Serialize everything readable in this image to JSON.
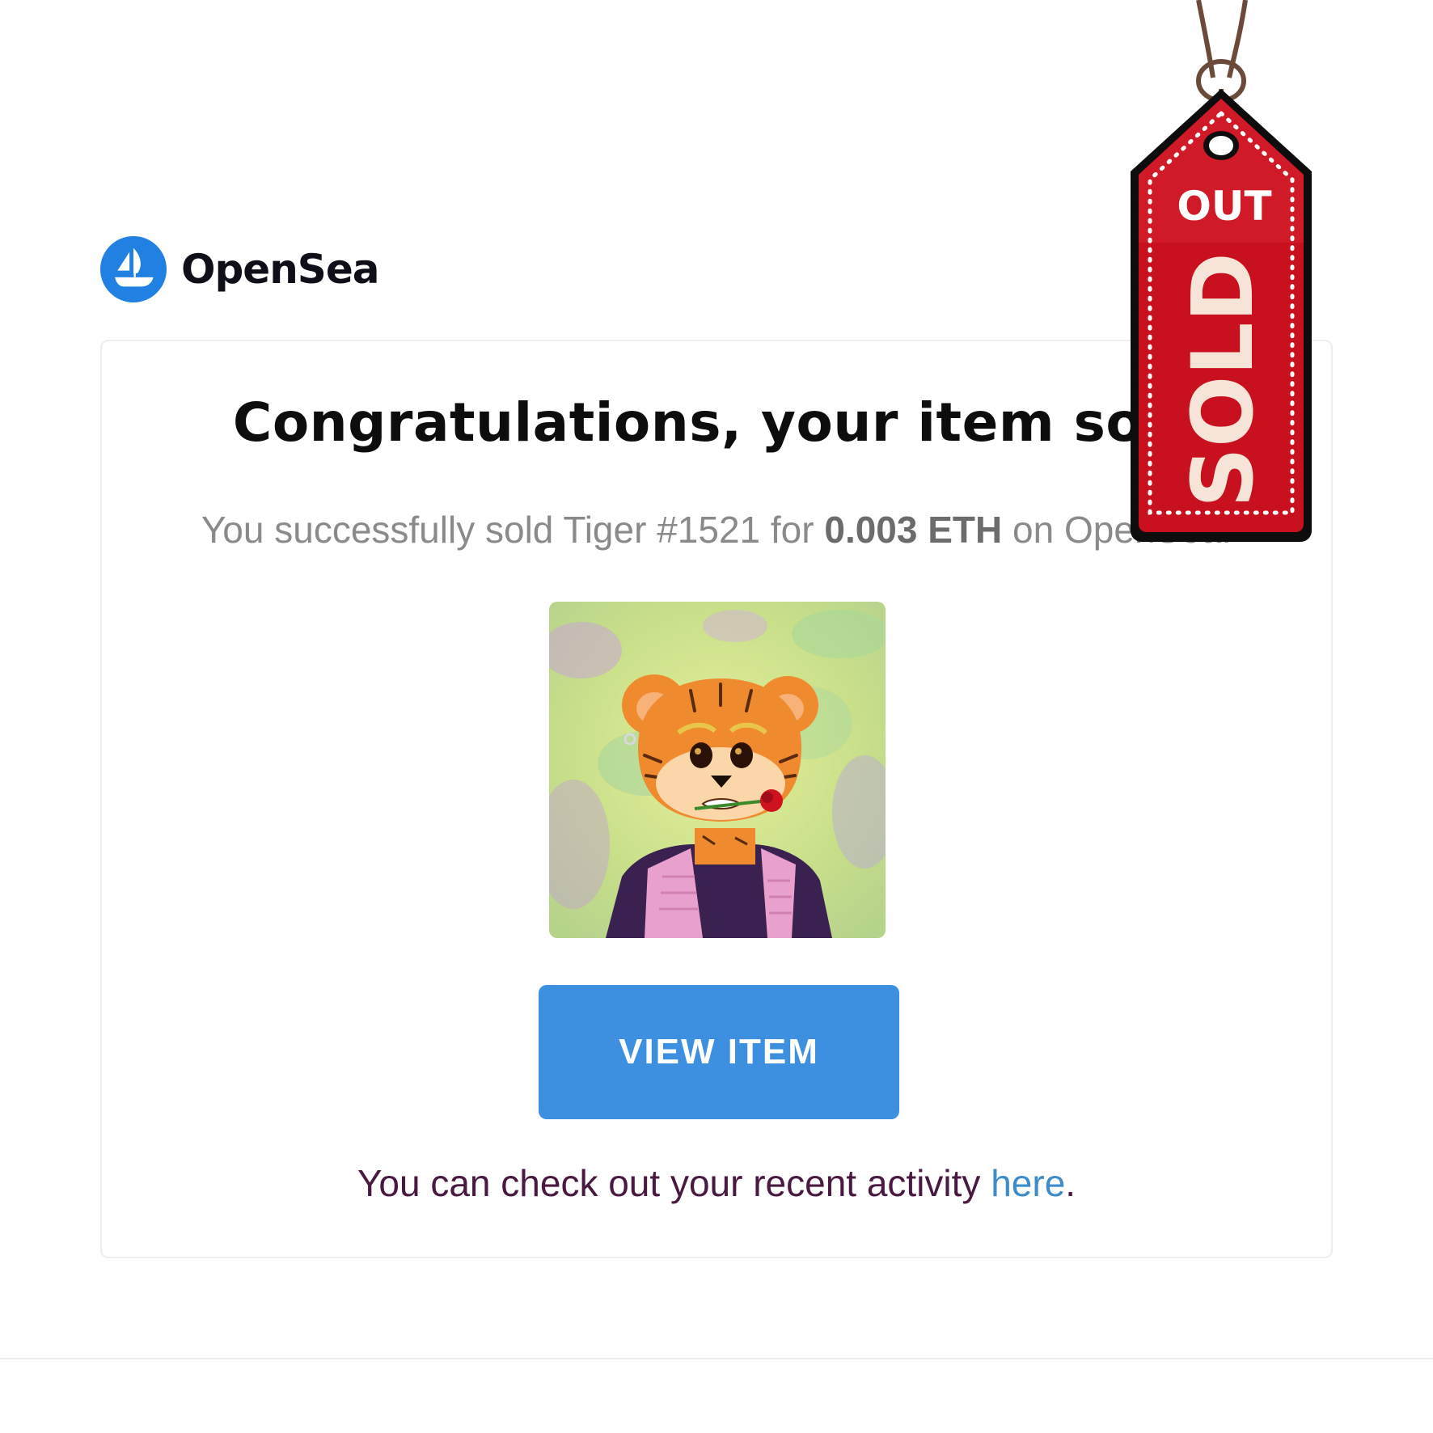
{
  "brand": {
    "name": "OpenSea",
    "icon": "opensea-logo-icon",
    "color": "#2081e2"
  },
  "card": {
    "headline": "Congratulations, your item sold",
    "subline": {
      "prefix": "You successfully sold Tiger #1521 for ",
      "amount": "0.003 ETH",
      "suffix": " on OpenSea."
    },
    "item_image_alt": "Tiger #1521",
    "view_button_label": "VIEW ITEM",
    "activity": {
      "text": "You can check out your recent activity ",
      "link_label": "here",
      "end": "."
    }
  },
  "sold_tag": {
    "top_label": "OUT",
    "main_label": "SOLD",
    "color": "#c8101e"
  },
  "colors": {
    "button": "#3d8fe0",
    "activity_text": "#4a1942",
    "link": "#3d8bc9"
  }
}
